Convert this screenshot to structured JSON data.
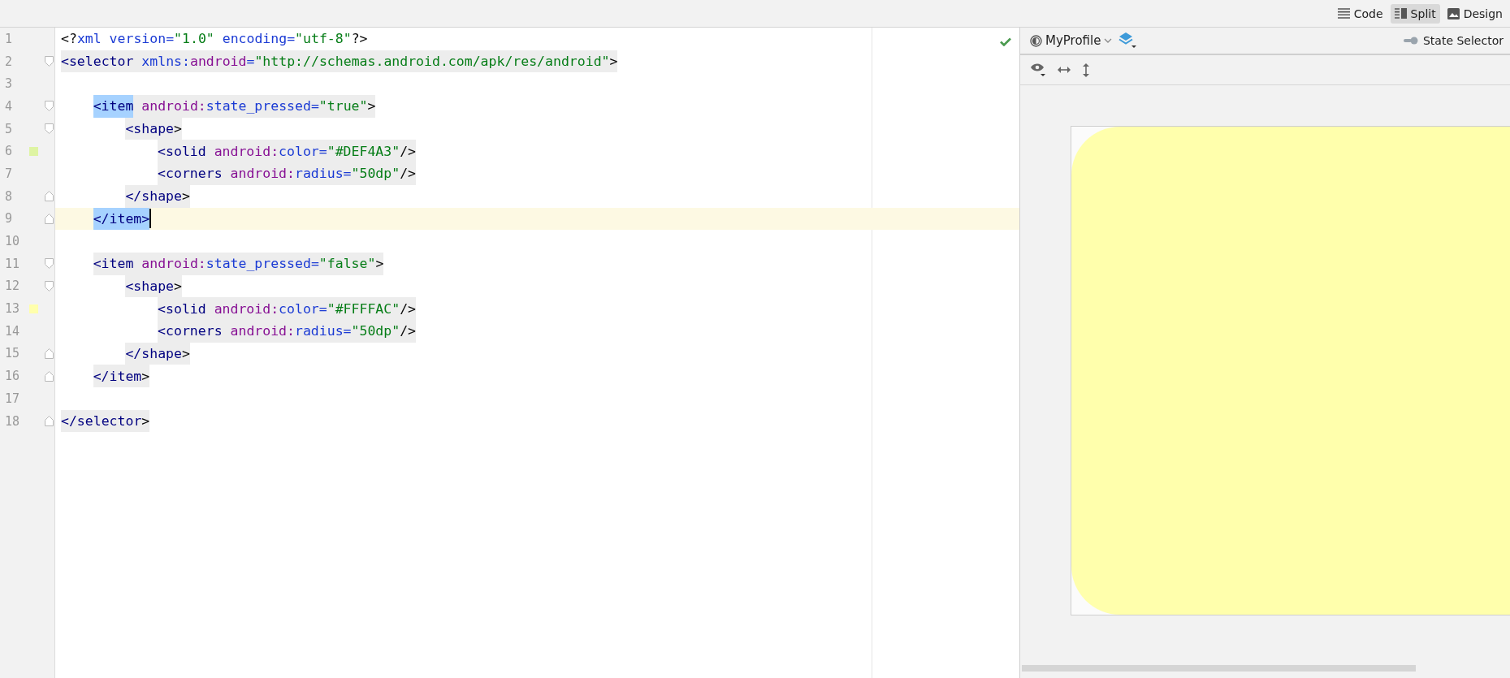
{
  "view_modes": [
    {
      "label": "Code",
      "selected": false
    },
    {
      "label": "Split",
      "selected": true
    },
    {
      "label": "Design",
      "selected": false
    }
  ],
  "editor": {
    "lines": [
      {
        "number": "1",
        "shaded": false,
        "current": false,
        "segments": [
          {
            "kind": "punct",
            "text": "<?",
            "highlighted": false
          },
          {
            "kind": "attr",
            "text": "xml version=",
            "highlighted": false
          },
          {
            "kind": "str",
            "text": "\"1.0\"",
            "highlighted": false
          },
          {
            "kind": "attr",
            "text": " encoding=",
            "highlighted": false
          },
          {
            "kind": "str",
            "text": "\"utf-8\"",
            "highlighted": false
          },
          {
            "kind": "punct",
            "text": "?>",
            "highlighted": false
          }
        ]
      },
      {
        "number": "2",
        "kind": "open",
        "shaded": true,
        "current": false,
        "segments": [
          {
            "kind": "tag",
            "text": "<selector",
            "highlighted": false
          },
          {
            "kind": "attr",
            "text": " xmlns:",
            "highlighted": false
          },
          {
            "kind": "ns",
            "text": "android",
            "highlighted": false
          },
          {
            "kind": "attr",
            "text": "=",
            "highlighted": false
          },
          {
            "kind": "str",
            "text": "\"http://schemas.android.com/apk/res/android\"",
            "highlighted": false
          },
          {
            "kind": "punct",
            "text": ">",
            "highlighted": false
          }
        ],
        "children": [
          {
            "number": "3",
            "current": false
          },
          {
            "number": "4",
            "kind": "open",
            "shaded": true,
            "current": false,
            "segments": [
              {
                "kind": "tag",
                "text": "<item",
                "highlighted": true
              },
              {
                "kind": "ns",
                "text": " android:",
                "highlighted": false
              },
              {
                "kind": "attr",
                "text": "state_pressed=",
                "highlighted": false
              },
              {
                "kind": "str",
                "text": "\"true\"",
                "highlighted": false
              },
              {
                "kind": "punct",
                "text": ">",
                "highlighted": false
              }
            ],
            "children": [
              {
                "number": "5",
                "kind": "open",
                "shaded": true,
                "current": false,
                "segments": [
                  {
                    "kind": "tag",
                    "text": "<shape",
                    "highlighted": false
                  },
                  {
                    "kind": "punct",
                    "text": ">",
                    "highlighted": false
                  }
                ],
                "children": [
                  {
                    "number": "6",
                    "shaded": true,
                    "current": false,
                    "color": "#def4a3",
                    "segments": [
                      {
                        "kind": "tag",
                        "text": "<solid",
                        "highlighted": false
                      },
                      {
                        "kind": "ns",
                        "text": " android:",
                        "highlighted": false
                      },
                      {
                        "kind": "attr",
                        "text": "color=",
                        "highlighted": false
                      },
                      {
                        "kind": "str",
                        "text": "\"#DEF4A3\"",
                        "highlighted": false
                      },
                      {
                        "kind": "punct",
                        "text": "/>",
                        "highlighted": false
                      }
                    ]
                  },
                  {
                    "number": "7",
                    "shaded": true,
                    "current": false,
                    "segments": [
                      {
                        "kind": "tag",
                        "text": "<corners",
                        "highlighted": false
                      },
                      {
                        "kind": "ns",
                        "text": " android:",
                        "highlighted": false
                      },
                      {
                        "kind": "attr",
                        "text": "radius=",
                        "highlighted": false
                      },
                      {
                        "kind": "str",
                        "text": "\"50dp\"",
                        "highlighted": false
                      },
                      {
                        "kind": "punct",
                        "text": "/>",
                        "highlighted": false
                      }
                    ]
                  }
                ]
              },
              {
                "number": "8",
                "kind": "close",
                "shaded": true,
                "current": false,
                "segments": [
                  {
                    "kind": "tag",
                    "text": "</shape",
                    "highlighted": false
                  },
                  {
                    "kind": "punct",
                    "text": ">",
                    "highlighted": false
                  }
                ]
              }
            ]
          },
          {
            "number": "9",
            "kind": "close",
            "shaded": true,
            "current": true,
            "segments": [
              {
                "kind": "tag",
                "text": "</item>",
                "highlighted": true
              }
            ]
          },
          {
            "number": "10",
            "current": false
          },
          {
            "number": "11",
            "kind": "open",
            "shaded": true,
            "current": false,
            "segments": [
              {
                "kind": "tag",
                "text": "<item",
                "highlighted": false
              },
              {
                "kind": "ns",
                "text": " android:",
                "highlighted": false
              },
              {
                "kind": "attr",
                "text": "state_pressed=",
                "highlighted": false
              },
              {
                "kind": "str",
                "text": "\"false\"",
                "highlighted": false
              },
              {
                "kind": "punct",
                "text": ">",
                "highlighted": false
              }
            ],
            "children": [
              {
                "number": "12",
                "kind": "open",
                "shaded": true,
                "current": false,
                "segments": [
                  {
                    "kind": "tag",
                    "text": "<shape",
                    "highlighted": false
                  },
                  {
                    "kind": "punct",
                    "text": ">",
                    "highlighted": false
                  }
                ],
                "children": [
                  {
                    "number": "13",
                    "shaded": true,
                    "current": false,
                    "color": "#ffffac",
                    "segments": [
                      {
                        "kind": "tag",
                        "text": "<solid",
                        "highlighted": false
                      },
                      {
                        "kind": "ns",
                        "text": " android:",
                        "highlighted": false
                      },
                      {
                        "kind": "attr",
                        "text": "color=",
                        "highlighted": false
                      },
                      {
                        "kind": "str",
                        "text": "\"#FFFFAC\"",
                        "highlighted": false
                      },
                      {
                        "kind": "punct",
                        "text": "/>",
                        "highlighted": false
                      }
                    ]
                  },
                  {
                    "number": "14",
                    "shaded": true,
                    "current": false,
                    "segments": [
                      {
                        "kind": "tag",
                        "text": "<corners",
                        "highlighted": false
                      },
                      {
                        "kind": "ns",
                        "text": " android:",
                        "highlighted": false
                      },
                      {
                        "kind": "attr",
                        "text": "radius=",
                        "highlighted": false
                      },
                      {
                        "kind": "str",
                        "text": "\"50dp\"",
                        "highlighted": false
                      },
                      {
                        "kind": "punct",
                        "text": "/>",
                        "highlighted": false
                      }
                    ]
                  }
                ]
              },
              {
                "number": "15",
                "kind": "close",
                "shaded": true,
                "current": false,
                "segments": [
                  {
                    "kind": "tag",
                    "text": "</shape",
                    "highlighted": false
                  },
                  {
                    "kind": "punct",
                    "text": ">",
                    "highlighted": false
                  }
                ]
              }
            ]
          },
          {
            "number": "16",
            "kind": "close",
            "shaded": true,
            "current": false,
            "segments": [
              {
                "kind": "tag",
                "text": "</item",
                "highlighted": false
              },
              {
                "kind": "punct",
                "text": ">",
                "highlighted": false
              }
            ]
          },
          {
            "number": "17",
            "current": false
          }
        ]
      },
      {
        "number": "18",
        "kind": "close",
        "shaded": true,
        "current": false,
        "segments": [
          {
            "kind": "tag",
            "text": "</selector",
            "highlighted": false
          },
          {
            "kind": "punct",
            "text": ">",
            "highlighted": false
          }
        ]
      }
    ]
  },
  "preview": {
    "theme": "MyProfile",
    "state_selector": "State Selector"
  }
}
